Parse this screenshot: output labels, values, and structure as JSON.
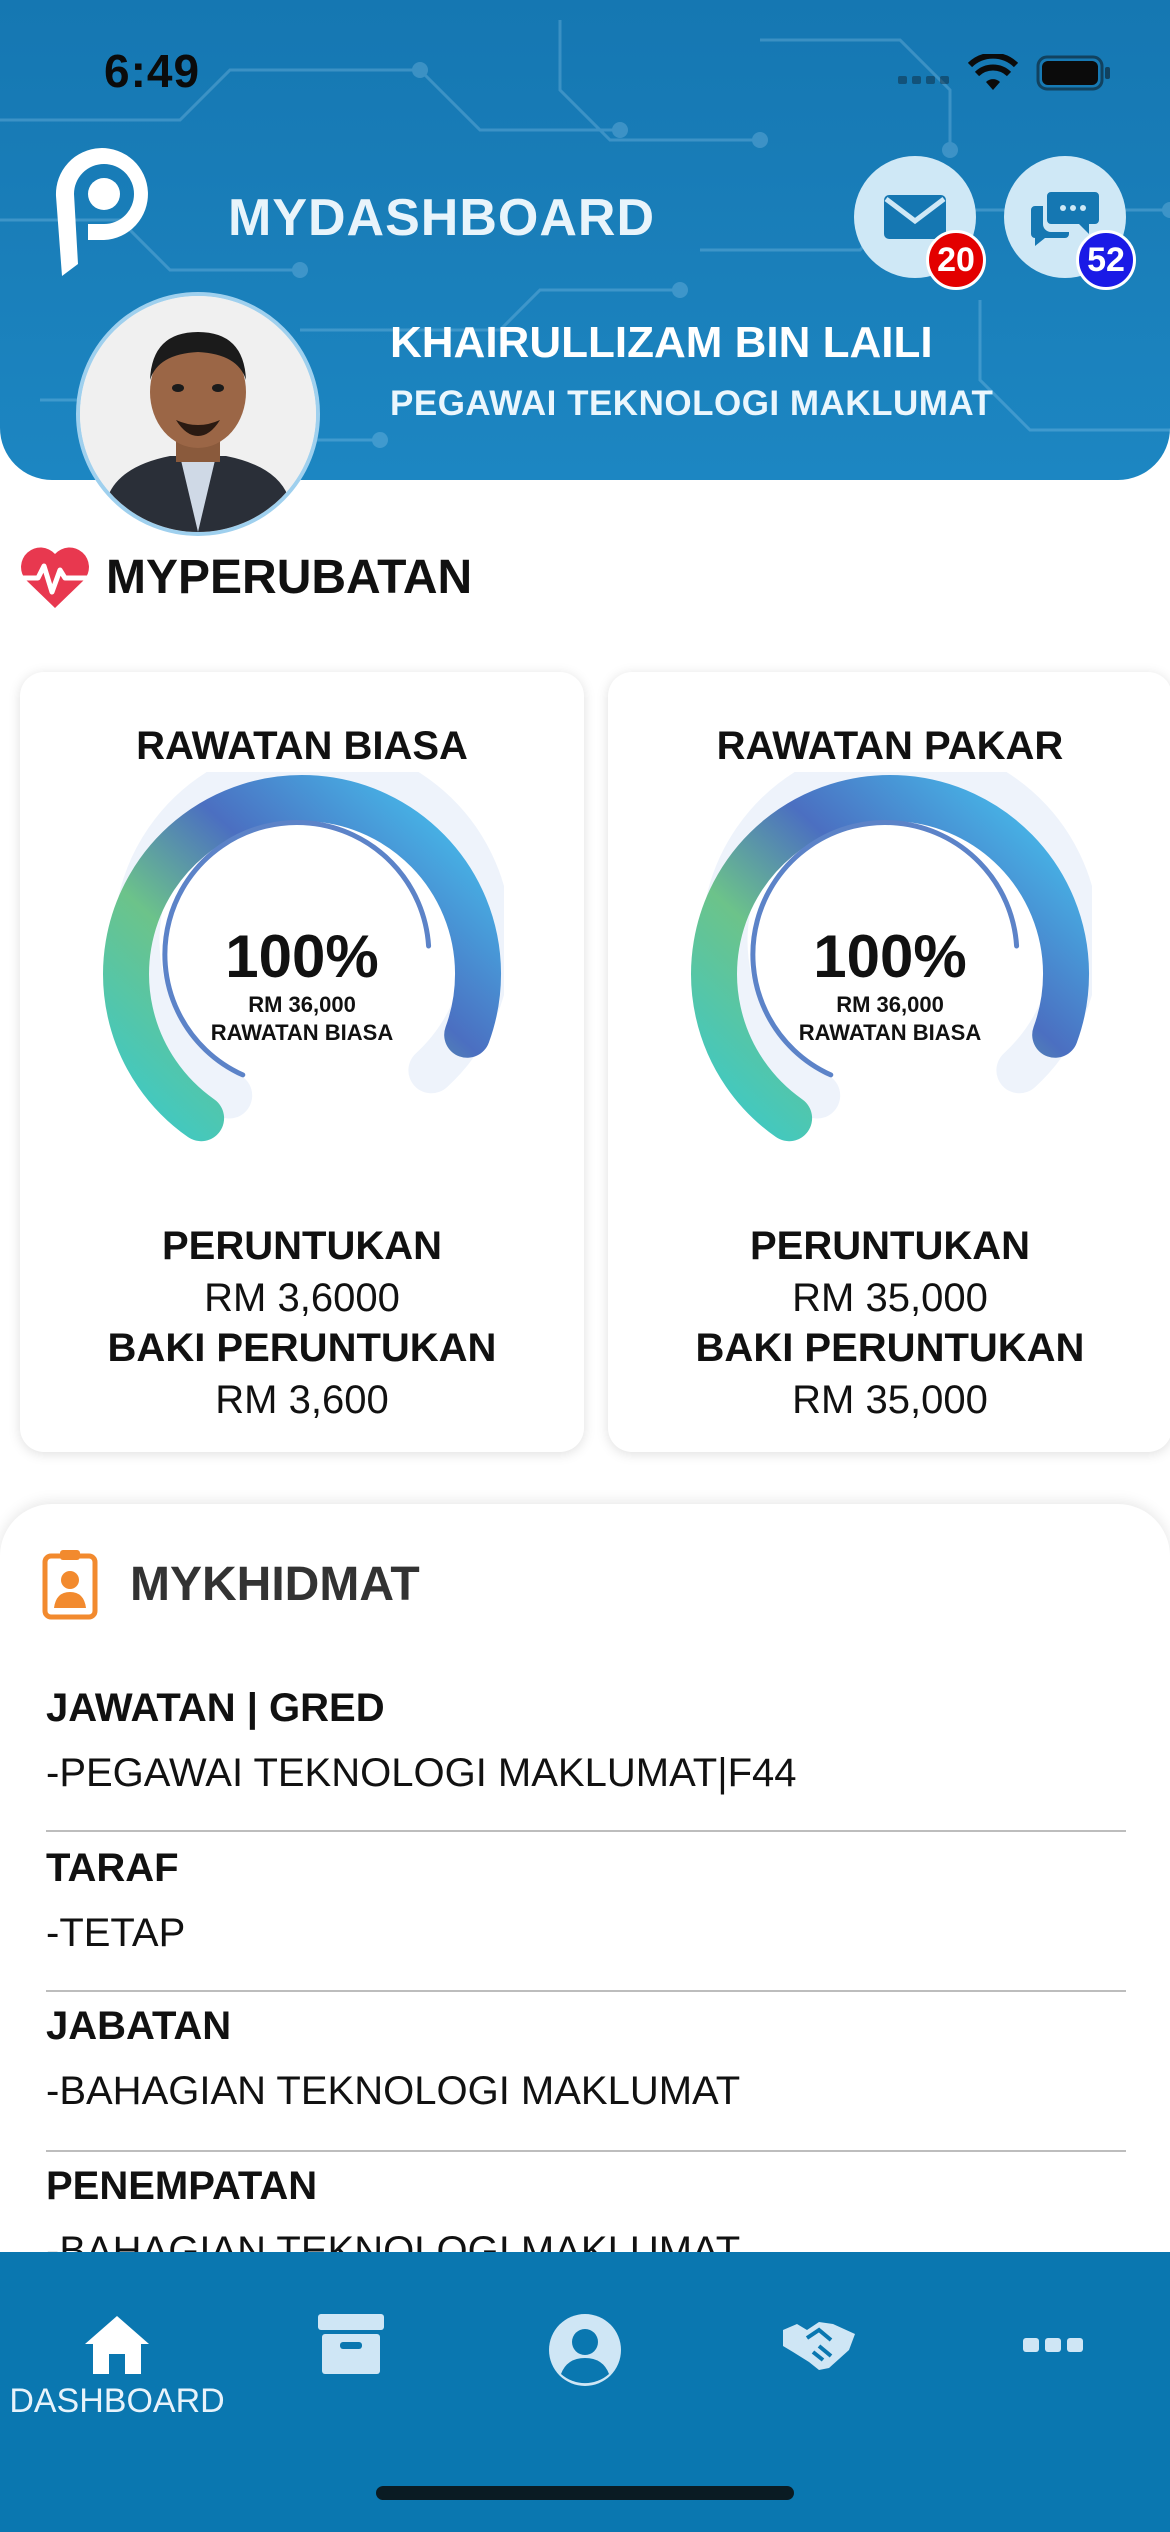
{
  "status_bar": {
    "time": "6:49"
  },
  "header": {
    "app_title": "MYDASHBOARD",
    "mail_badge": "20",
    "chat_badge": "52",
    "user_name": "KHAIRULLIZAM BIN LAILI",
    "user_role": "PEGAWAI TEKNOLOGI MAKLUMAT",
    "colors": {
      "header_bg": "#1577b2",
      "mail_badge": "#e30000",
      "chat_badge": "#1a1ae6"
    }
  },
  "myperubatan": {
    "title": "MYPERUBATAN",
    "cards": [
      {
        "title": "RAWATAN BIASA",
        "gauge_percent": "100%",
        "gauge_amount": "RM 36,000",
        "gauge_caption": "RAWATAN BIASA",
        "gauge_fill": 1.0,
        "allocation_label": "PERUNTUKAN",
        "allocation_value": "RM 3,6000",
        "balance_label": "BAKI PERUNTUKAN",
        "balance_value": "RM 3,600"
      },
      {
        "title": "RAWATAN PAKAR",
        "gauge_percent": "100%",
        "gauge_amount": "RM 36,000",
        "gauge_caption": "RAWATAN BIASA",
        "gauge_fill": 1.0,
        "allocation_label": "PERUNTUKAN",
        "allocation_value": "RM 35,000",
        "balance_label": "BAKI PERUNTUKAN",
        "balance_value": "RM 35,000"
      }
    ]
  },
  "mykhidmat": {
    "title": "MYKHIDMAT",
    "rows": [
      {
        "label": "JAWATAN | GRED",
        "value": "-PEGAWAI TEKNOLOGI MAKLUMAT|F44"
      },
      {
        "label": "TARAF",
        "value": "-TETAP"
      },
      {
        "label": "JABATAN",
        "value": "-BAHAGIAN TEKNOLOGI MAKLUMAT"
      },
      {
        "label": "PENEMPATAN",
        "value": "-BAHAGIAN TEKNOLOGI MAKLUMAT"
      }
    ]
  },
  "tabbar": {
    "items": [
      {
        "label": "DASHBOARD",
        "icon": "home-icon"
      },
      {
        "label": "",
        "icon": "archive-icon"
      },
      {
        "label": "",
        "icon": "user-icon"
      },
      {
        "label": "",
        "icon": "handshake-icon"
      },
      {
        "label": "",
        "icon": "more-icon"
      }
    ]
  }
}
